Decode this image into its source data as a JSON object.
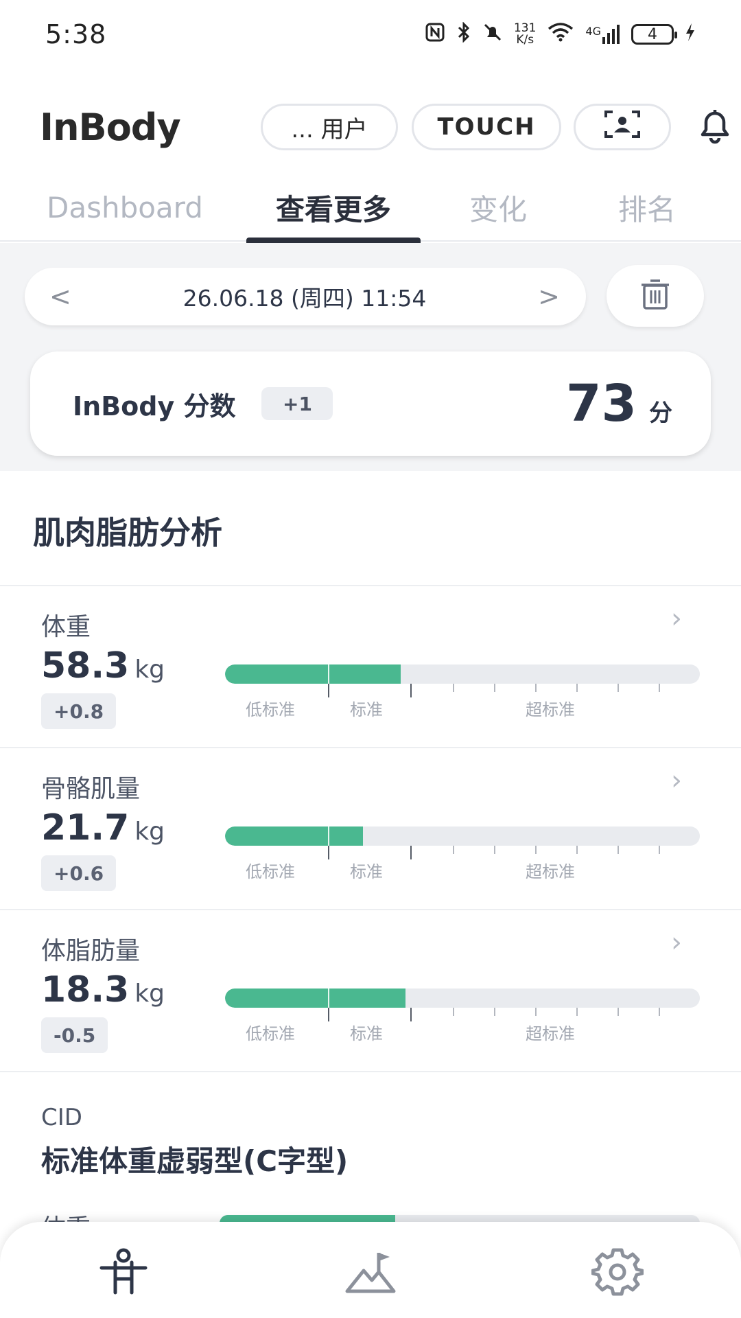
{
  "status_bar": {
    "time": "5:38",
    "net_speed_top": "131",
    "net_speed_bottom": "K/s",
    "network": "4G",
    "battery": "4"
  },
  "header": {
    "logo": "InBody",
    "user_label": "... 用户",
    "touch_label": "TOUCH"
  },
  "tabs": [
    {
      "label": "Dashboard"
    },
    {
      "label": "查看更多"
    },
    {
      "label": "变化"
    },
    {
      "label": "排名"
    }
  ],
  "date_nav": {
    "prev": "<",
    "date": "26.06.18 (周四) 11:54",
    "next": ">"
  },
  "score": {
    "label": "InBody 分数",
    "delta": "+1",
    "value": "73",
    "unit": "分"
  },
  "section": {
    "title": "肌肉脂肪分析"
  },
  "range_labels": {
    "low": "低标准",
    "normal": "标准",
    "high": "超标准"
  },
  "metrics": [
    {
      "name": "体重",
      "value": "58.3",
      "unit": "kg",
      "delta": "+0.8",
      "fill_fraction": 0.37
    },
    {
      "name": "骨骼肌量",
      "value": "21.7",
      "unit": "kg",
      "delta": "+0.6",
      "fill_fraction": 0.29
    },
    {
      "name": "体脂肪量",
      "value": "18.3",
      "unit": "kg",
      "delta": "-0.5",
      "fill_fraction": 0.38
    }
  ],
  "cid": {
    "label": "CID",
    "title": "标准体重虚弱型(C字型)",
    "peek_label": "体重"
  },
  "colors": {
    "accent": "#4ab890",
    "text_dark": "#2d3547",
    "background_grey": "#f3f4f6"
  }
}
